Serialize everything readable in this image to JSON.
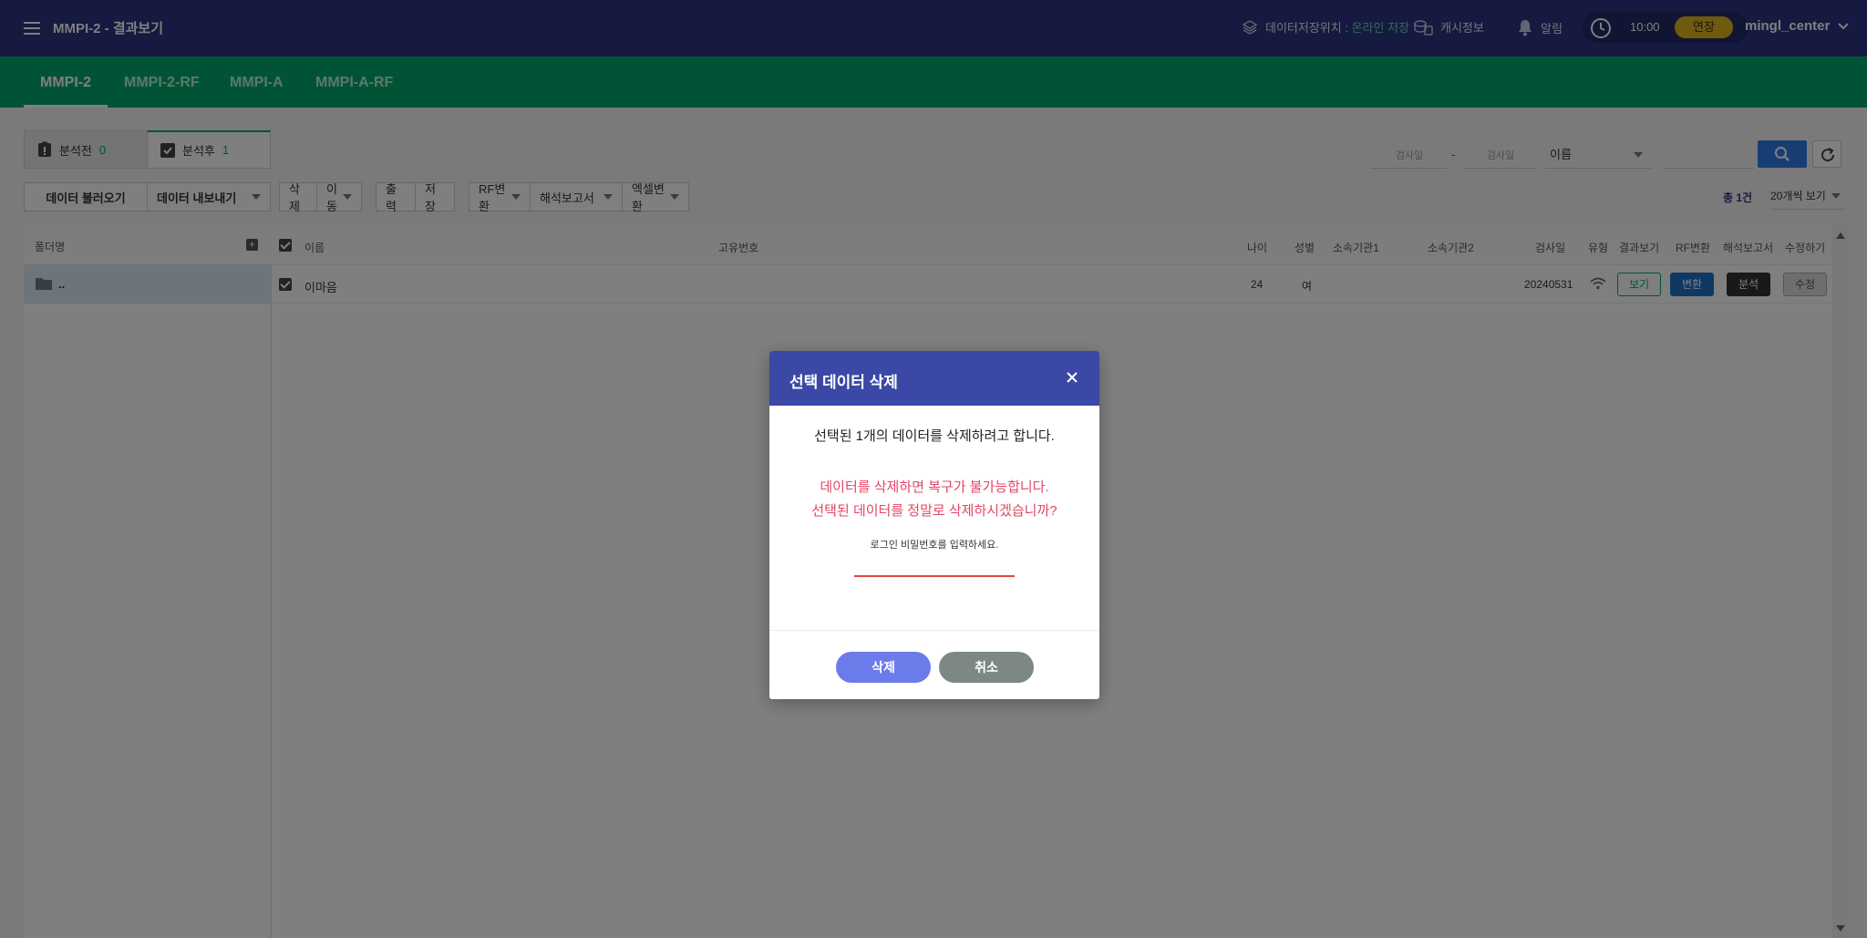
{
  "header": {
    "app_title": "MMPI-2 - 결과보기",
    "storage_label": "데이터저장위치 :",
    "storage_value": "온라인 저장",
    "cash_label": "캐시정보",
    "alarm_label": "알림",
    "time": "10:00",
    "extend_label": "연장",
    "username": "mingl_center"
  },
  "tabs": [
    {
      "label": "MMPI-2",
      "active": true
    },
    {
      "label": "MMPI-2-RF",
      "active": false
    },
    {
      "label": "MMPI-A",
      "active": false
    },
    {
      "label": "MMPI-A-RF",
      "active": false
    }
  ],
  "subtabs": {
    "before": {
      "label": "분석전",
      "count": "0"
    },
    "after": {
      "label": "분석후",
      "count": "1"
    }
  },
  "search": {
    "date_from_placeholder": "검사일",
    "date_to_placeholder": "검사일",
    "date_separator": "-",
    "field_select": "이름"
  },
  "toolbar": {
    "import": "데이터 불러오기",
    "export": "데이터 내보내기",
    "delete": "삭제",
    "move": "이동",
    "print": "출력",
    "save": "저장",
    "rf_convert": "RF변환",
    "report": "해석보고서",
    "excel": "엑셀변환",
    "total": "총 1건",
    "per_page": "20개씩 보기"
  },
  "folders": {
    "header": "폴더명",
    "rows": [
      {
        "name": ".."
      }
    ]
  },
  "table": {
    "columns": {
      "name": "이름",
      "id": "고유번호",
      "age": "나이",
      "gender": "성별",
      "org1": "소속기관1",
      "org2": "소속기관2",
      "date": "검사일",
      "type": "유형",
      "result": "결과보기",
      "rf": "RF변환",
      "report": "해석보고서",
      "edit": "수정하기"
    },
    "rows": [
      {
        "name": "이마음",
        "id": "",
        "age": "24",
        "gender": "여",
        "org1": "",
        "org2": "",
        "date": "20240531",
        "btn_view": "보기",
        "btn_convert": "변환",
        "btn_analyze": "분석",
        "btn_edit": "수정"
      }
    ]
  },
  "modal": {
    "title": "선택 데이터 삭제",
    "message": "선택된 1개의 데이터를 삭제하려고 합니다.",
    "warning_line1": "데이터를 삭제하면 복구가 불가능합니다.",
    "warning_line2": "선택된 데이터를 정말로 삭제하시겠습니까?",
    "password_hint": "로그인 비밀번호를 입력하세요.",
    "password_value": "",
    "delete_button": "삭제",
    "cancel_button": "취소"
  },
  "colors": {
    "header_bg": "#2d3580",
    "tab_bg": "#00a86b",
    "modal_header": "#3b48a6",
    "warning_text": "#e54567",
    "delete_button": "#6c7bea",
    "cancel_button": "#7d8885"
  },
  "icons": [
    "menu-icon",
    "layers-icon",
    "coins-icon",
    "bell-icon",
    "clock-icon",
    "chevron-down-icon",
    "search-icon",
    "refresh-icon",
    "folder-icon",
    "wifi-icon",
    "close-icon"
  ]
}
